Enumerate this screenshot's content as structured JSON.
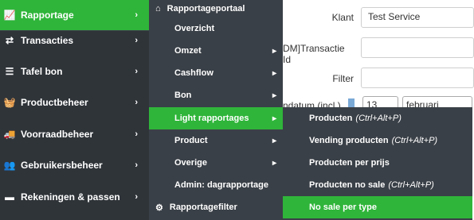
{
  "sidebar": {
    "items": [
      {
        "label": "Rapportage",
        "icon": "chart-line-icon",
        "glyph": "📈"
      },
      {
        "label": "Transacties",
        "icon": "exchange-icon",
        "glyph": "⇄"
      },
      {
        "label": "Tafel bon",
        "icon": "list-icon",
        "glyph": "☰"
      },
      {
        "label": "Productbeheer",
        "icon": "basket-icon",
        "glyph": "🧺"
      },
      {
        "label": "Voorraadbeheer",
        "icon": "truck-icon",
        "glyph": "🚚"
      },
      {
        "label": "Gebruikersbeheer",
        "icon": "users-icon",
        "glyph": "👥"
      },
      {
        "label": "Rekeningen & passen",
        "icon": "credit-card-icon",
        "glyph": "▬"
      }
    ],
    "chevron": "›"
  },
  "form": {
    "klant_label": "Klant",
    "klant_value": "Test Service",
    "transactie_label": "DM]Transactie Id",
    "filter_label": "Filter",
    "datum_label": "ndatum (incl.)",
    "day_value": "13",
    "month_value": "februari"
  },
  "menu1": {
    "header": "Rapportageportaal",
    "items": [
      {
        "label": "Overzicht",
        "has_sub": false
      },
      {
        "label": "Omzet",
        "has_sub": true
      },
      {
        "label": "Cashflow",
        "has_sub": true
      },
      {
        "label": "Bon",
        "has_sub": true
      },
      {
        "label": "Light rapportages",
        "has_sub": true
      },
      {
        "label": "Product",
        "has_sub": true
      },
      {
        "label": "Overige",
        "has_sub": true
      },
      {
        "label": "Admin: dagrapportage",
        "has_sub": false
      }
    ],
    "footer": "Rapportagefilter",
    "chevron": "▸"
  },
  "menu2": {
    "items": [
      {
        "label": "Producten",
        "shortcut": "(Ctrl+Alt+P)"
      },
      {
        "label": "Vending producten",
        "shortcut": "(Ctrl+Alt+P)"
      },
      {
        "label": "Producten per prijs",
        "shortcut": ""
      },
      {
        "label": "Producten no sale",
        "shortcut": "(Ctrl+Alt+P)"
      },
      {
        "label": "No sale per type",
        "shortcut": ""
      }
    ]
  },
  "colors": {
    "accent": "#2fb53a",
    "sidebar_bg": "#2f3439",
    "menu_bg": "#3a4047"
  }
}
